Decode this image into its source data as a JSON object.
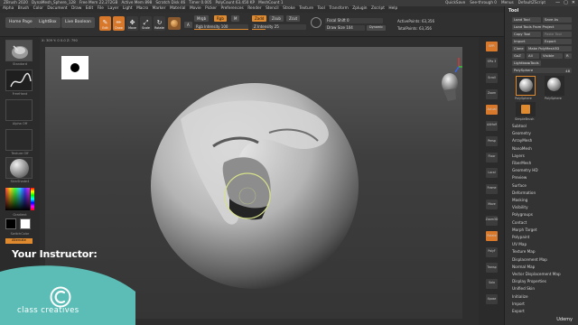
{
  "titlebar": {
    "app": "ZBrush 2020",
    "file": "DynaMesh_Sphere_128",
    "free_mem": "Free Mem 22.272GB",
    "active_mem": "Active Mem 898",
    "scratch": "Scratch Disk 46",
    "timer": "Timer 0.005",
    "polycount": "PolyCount 63.450 KP",
    "meshcount": "MeshCount 1",
    "quicksave": "QuickSave",
    "seethrough": "See-through 0",
    "menus": "Menus",
    "script": "DefaultZScript",
    "window_buttons": [
      "—",
      "▢",
      "✕"
    ]
  },
  "menubar": [
    "Alpha",
    "Brush",
    "Color",
    "Document",
    "Draw",
    "Edit",
    "File",
    "Layer",
    "Light",
    "Macro",
    "Marker",
    "Material",
    "Movie",
    "Picker",
    "Preferences",
    "Render",
    "Stencil",
    "Stroke",
    "Texture",
    "Tool",
    "Transform",
    "Zplugin",
    "Zscript",
    "Help"
  ],
  "toolbar": {
    "home_page": "Home Page",
    "lightbox": "LightBox",
    "live_boolean": "Live Boolean",
    "tools": [
      {
        "label": "Edit",
        "glyph": "✎",
        "active": true
      },
      {
        "label": "Draw",
        "glyph": "✏",
        "active": true
      },
      {
        "label": "Move",
        "glyph": "✥",
        "active": false
      },
      {
        "label": "Scale",
        "glyph": "⤢",
        "active": false
      },
      {
        "label": "Rotate",
        "glyph": "↻",
        "active": false
      }
    ],
    "a_label": "A",
    "mrgb": "Mrgb",
    "rgb": "Rgb",
    "m": "M",
    "zadd": "Zadd",
    "zsub": "Zsub",
    "zcut": "Zcut",
    "rgb_intensity": "Rgb Intensity 100",
    "z_intensity": "Z Intensity 25",
    "focal_shift": "Focal Shift 0",
    "draw_size": "Draw Size 104",
    "dynamic": "Dynamic",
    "active_points": "ActivePoints: 63,356",
    "total_points": "TotalPoints: 63,356",
    "z_intensity_level": 0.25,
    "rgb_intensity_level": 1.0
  },
  "left_shelf": {
    "brush_label": "Standard",
    "stroke_label": "FreeHand",
    "alpha_label": "Alpha Off",
    "texture_label": "Texture Off",
    "material_label": "SkinShade4",
    "gradient_label": "Gradient",
    "switch_color": "SwitchColor",
    "alternate": "Alternate"
  },
  "viewport": {
    "doc_info": "X: 309 Y: 0 0.0 Z: 790"
  },
  "right_shelf": [
    "BPR",
    "SPix 3",
    "Scroll",
    "Zoom",
    "Actual",
    "AAHalf",
    "Persp",
    "Floor",
    "Local",
    "Frame",
    "Move",
    "Zoom3D",
    "Rotate",
    "PolyF",
    "Transp",
    "Solo",
    "Xpose"
  ],
  "palette": {
    "title": "Tool",
    "load_tool": "Load Tool",
    "save_as": "Save As",
    "load_from_project": "Load Tools From Project",
    "copy_tool": "Copy Tool",
    "paste_tool": "Paste Tool",
    "import": "Import",
    "export": "Export",
    "clone": "Clone",
    "make_polymesh": "Make PolyMesh3D",
    "goz": "GoZ",
    "all": "All",
    "visible": "Visible",
    "r": "R",
    "lightbox_tools": "Lightbox▸Tools",
    "polysphere_label": "PolySphere",
    "polysphere_value": "48",
    "thumb_labels": [
      "PolySphere",
      "PolySphere",
      "SimpleBrush"
    ],
    "subtools": [
      "Subtool",
      "Geometry",
      "ArrayMesh",
      "NanoMesh",
      "Layers",
      "FiberMesh",
      "Geometry HD",
      "Preview",
      "Surface",
      "Deformation",
      "Masking",
      "Visibility",
      "Polygroups",
      "Contact",
      "Morph Target",
      "Polypaint",
      "UV Map",
      "Texture Map",
      "Displacement Map",
      "Normal Map",
      "Vector Displacement Map",
      "Display Properties",
      "Unified Skin",
      "Initialize",
      "Import",
      "Export"
    ]
  },
  "overlay": {
    "instructor": "Your Instructor:",
    "brand": "class creatives",
    "brand_accent": "#5bbdb6",
    "udemy": "Udemy"
  }
}
